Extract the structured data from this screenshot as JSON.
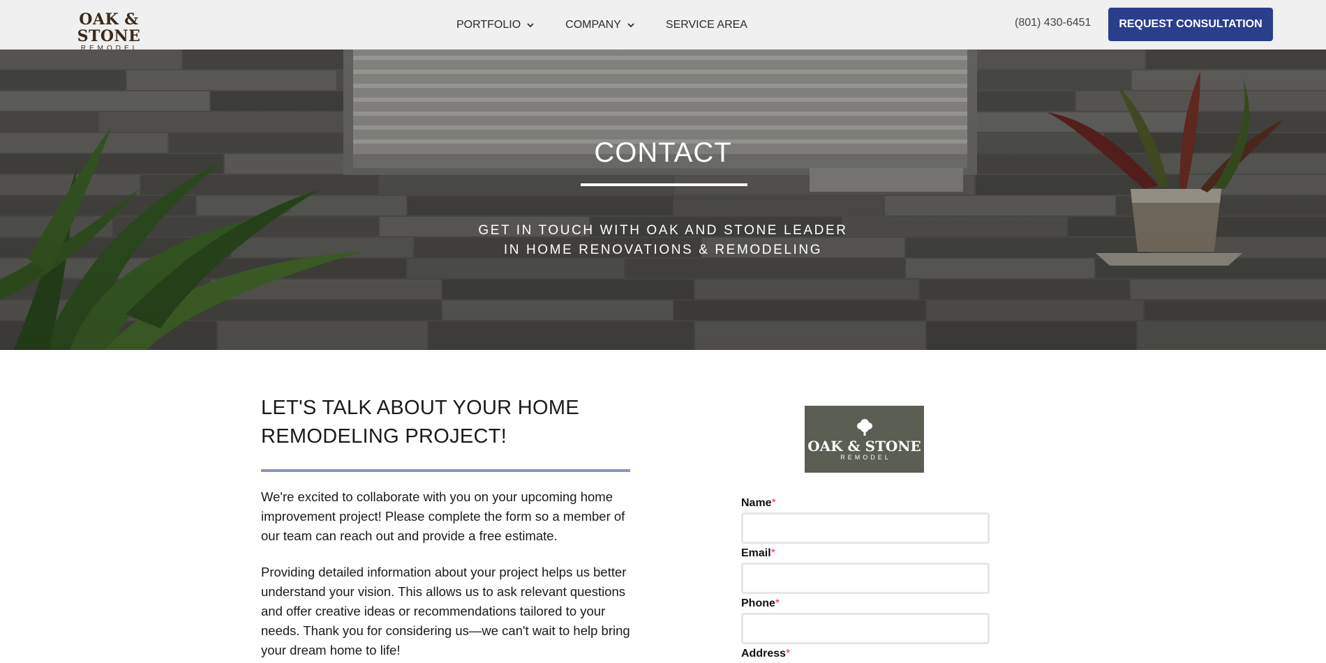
{
  "header": {
    "logo_main": "OAK & STONE",
    "logo_sub": "REMODEL",
    "nav": [
      {
        "label": "PORTFOLIO",
        "has_dropdown": true
      },
      {
        "label": "COMPANY",
        "has_dropdown": true
      },
      {
        "label": "SERVICE AREA",
        "has_dropdown": false
      }
    ],
    "phone": "(801) 430-6451",
    "cta_label": "REQUEST CONSULTATION"
  },
  "hero": {
    "title": "CONTACT",
    "subtitle_line1": "GET IN TOUCH WITH OAK AND STONE LEADER",
    "subtitle_line2": "IN HOME RENOVATIONS & REMODELING"
  },
  "intro": {
    "heading_line1": "LET'S TALK ABOUT YOUR HOME",
    "heading_line2": "REMODELING PROJECT!",
    "paragraph1": "We're excited to collaborate with you on your upcoming home improvement project! Please complete the form so a member of our team can reach out and provide a free estimate.",
    "paragraph2": "Providing detailed information about your project helps us better understand your vision. This allows us to ask relevant questions and offer creative ideas or recommendations tailored to your needs. Thank you for considering us—we can't wait to help bring your dream home to life!"
  },
  "form": {
    "logo_main": "OAK & STONE",
    "logo_sub": "REMODEL",
    "required_marker": "*",
    "fields": [
      {
        "label": "Name",
        "value": ""
      },
      {
        "label": "Email",
        "value": ""
      },
      {
        "label": "Phone",
        "value": ""
      },
      {
        "label": "Address",
        "value": ""
      }
    ]
  },
  "colors": {
    "brand_blue": "#2b3e8c",
    "rule_purple": "#8a90c4",
    "required_red": "#e0353a",
    "logo_brown": "#3b2a1a"
  }
}
